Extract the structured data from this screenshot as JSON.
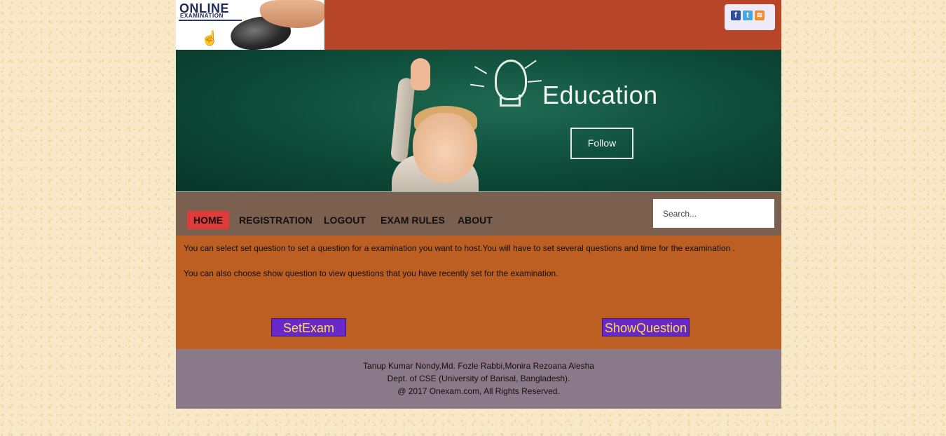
{
  "header": {
    "logo_title": "ONLINE",
    "logo_subtitle": "EXAMINATION",
    "social": [
      {
        "icon": "facebook-icon",
        "glyph": "f"
      },
      {
        "icon": "twitter-icon",
        "glyph": "t"
      },
      {
        "icon": "rss-icon",
        "glyph": "≋"
      }
    ]
  },
  "banner": {
    "title": "Education",
    "follow_label": "Follow"
  },
  "nav": {
    "items": [
      {
        "label": "HOME",
        "active": true
      },
      {
        "label": "REGISTRATION",
        "active": false
      },
      {
        "label": "LOGOUT",
        "active": false
      },
      {
        "label": "EXAM RULES",
        "active": false
      },
      {
        "label": "ABOUT",
        "active": false
      }
    ],
    "search_placeholder": "Search...",
    "search_value": ""
  },
  "content": {
    "para1": "You can select set question to set a question for a examination you want to host.You will have to set several questions and time for the examination .",
    "para2": "You can also choose show question to view questions that you have recently set for the examination.",
    "setexam_label": "SetExam",
    "showquestion_label": "ShowQuestion"
  },
  "footer": {
    "line1": "Tanup Kumar Nondy,Md. Fozle Rabbi,Monira Rezoana Alesha",
    "line2": "Dept. of CSE (University of Barisal, Bangladesh).",
    "line3": "@ 2017 Onexam.com, All Rights Reserved."
  },
  "colors": {
    "header_bg": "#b74528",
    "nav_bg": "#7b6050",
    "nav_active": "#e03b3b",
    "content_bg": "#bd5f22",
    "button_bg": "#6a27c9",
    "button_text": "#f4e24a",
    "footer_bg": "#8b7889"
  }
}
